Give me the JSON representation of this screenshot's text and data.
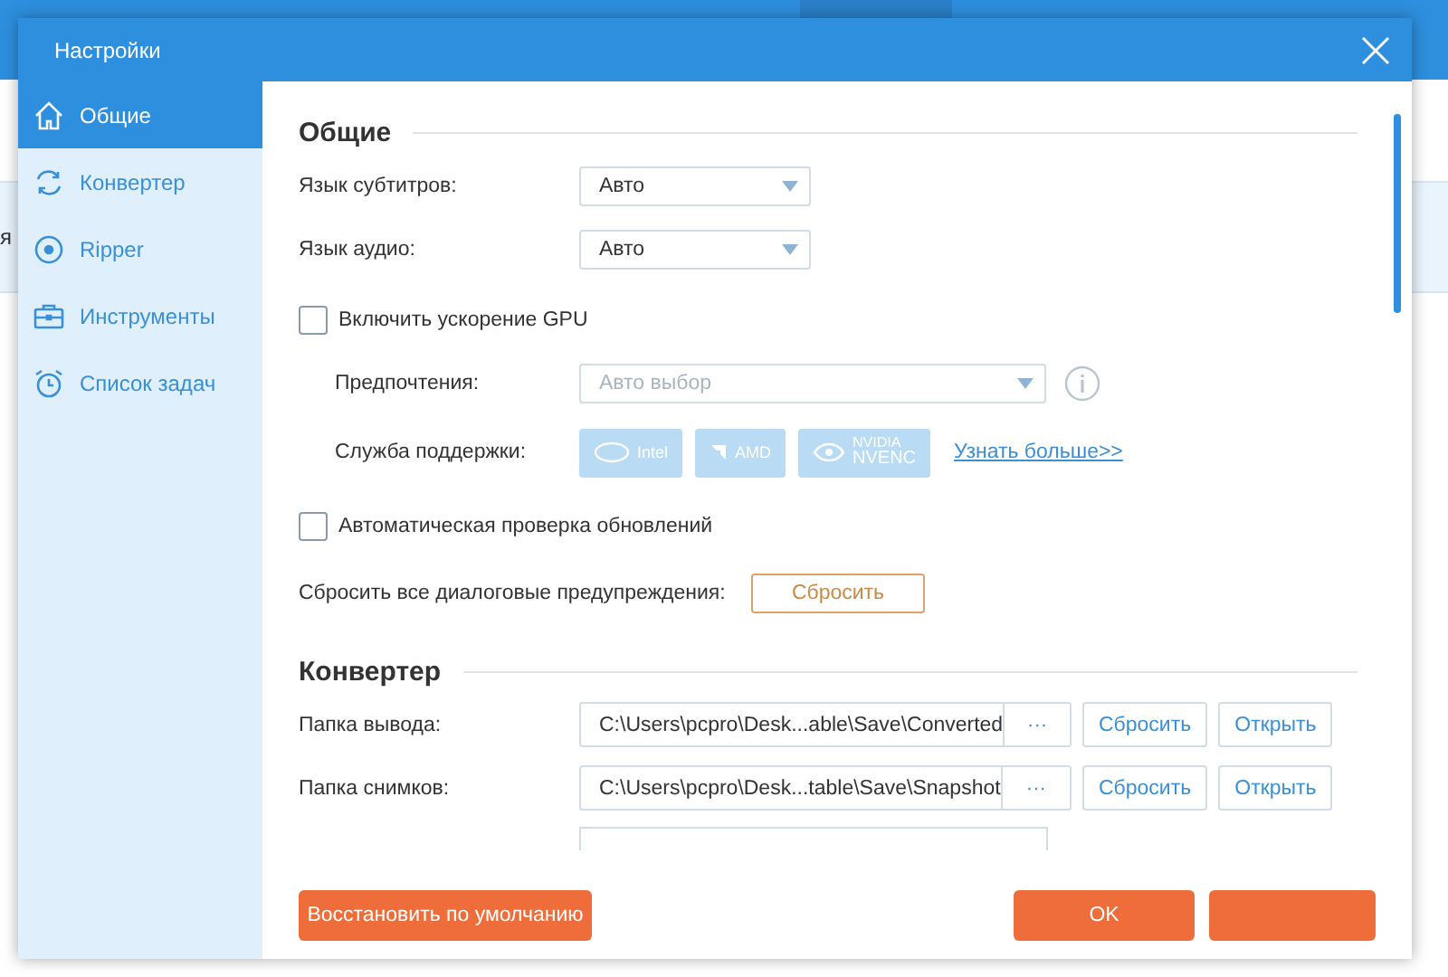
{
  "window": {
    "title": "Настройки"
  },
  "background": {
    "text": "я"
  },
  "sidebar": {
    "items": [
      {
        "label": "Общие",
        "selected": true
      },
      {
        "label": "Конвертер",
        "selected": false
      },
      {
        "label": "Ripper",
        "selected": false
      },
      {
        "label": "Инструменты",
        "selected": false
      },
      {
        "label": "Список задач",
        "selected": false
      }
    ]
  },
  "general": {
    "heading": "Общие",
    "selects": [
      {
        "label": "Язык субтитров:",
        "value": "Авто"
      },
      {
        "label": "Язык аудио:",
        "value": "Авто"
      }
    ],
    "gpu": {
      "label": "Включить ускорение GPU",
      "checked": false
    },
    "preference": {
      "label": "Предпочтения:",
      "value": "Авто выбор",
      "disabled": true
    },
    "support": {
      "label": "Служба поддержки:",
      "vendors": [
        {
          "kind": "intel",
          "text": "Intel"
        },
        {
          "kind": "amd",
          "text": "AMD"
        },
        {
          "kind": "nvidia",
          "text": "NVIDIA",
          "text2": "NVENC"
        }
      ],
      "link": "Узнать больше>>"
    },
    "auto_update": {
      "label": "Автоматическая проверка обновлений",
      "checked": false
    },
    "reset_warnings": {
      "label": "Сбросить все диалоговые предупреждения:",
      "button": "Сбросить"
    }
  },
  "converter": {
    "heading": "Конвертер",
    "folders": [
      {
        "label": "Папка вывода:",
        "path": "C:\\Users\\pcpro\\Desk...able\\Save\\Converted",
        "browse": "···",
        "reset": "Сбросить",
        "open": "Открыть"
      },
      {
        "label": "Папка снимков:",
        "path": "C:\\Users\\pcpro\\Desk...table\\Save\\Snapshot",
        "browse": "···",
        "reset": "Сбросить",
        "open": "Открыть"
      }
    ]
  },
  "footer": {
    "restore": "Восстановить по умолчанию",
    "ok": "OK"
  }
}
